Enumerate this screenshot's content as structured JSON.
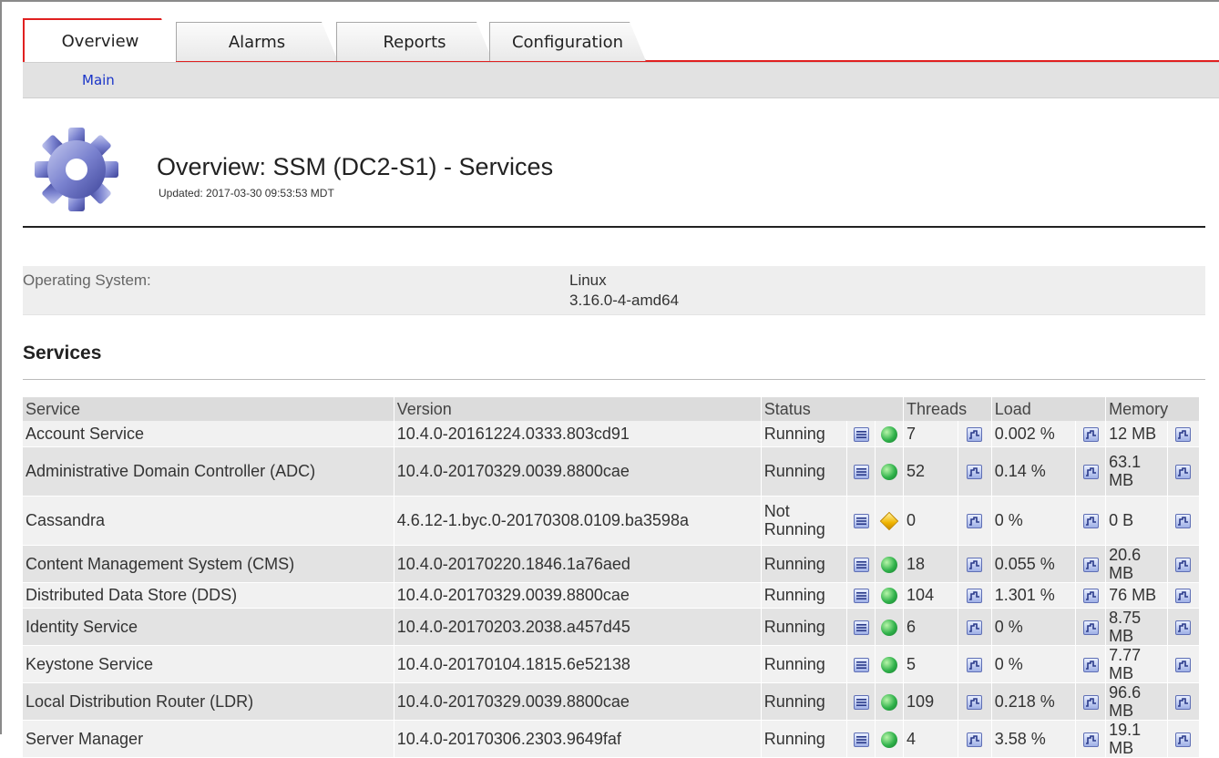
{
  "tabs": [
    {
      "label": "Overview",
      "active": true
    },
    {
      "label": "Alarms",
      "active": false
    },
    {
      "label": "Reports",
      "active": false
    },
    {
      "label": "Configuration",
      "active": false
    }
  ],
  "subnav": {
    "main": "Main"
  },
  "header": {
    "title": "Overview: SSM (DC2-S1) - Services",
    "updated": "Updated: 2017-03-30 09:53:53 MDT",
    "icon": "gear-icon"
  },
  "os": {
    "label": "Operating System:",
    "value_line1": "Linux",
    "value_line2": "3.16.0-4-amd64"
  },
  "services_heading": "Services",
  "table": {
    "headers": {
      "service": "Service",
      "version": "Version",
      "status": "Status",
      "threads": "Threads",
      "load": "Load",
      "memory": "Memory"
    },
    "rows": [
      {
        "service": "Account Service",
        "version": "10.4.0-20161224.0333.803cd91",
        "status": "Running",
        "state": "ok",
        "threads": "7",
        "load": "0.002 %",
        "memory": "12 MB"
      },
      {
        "service": "Administrative Domain Controller (ADC)",
        "version": "10.4.0-20170329.0039.8800cae",
        "status": "Running",
        "state": "ok",
        "threads": "52",
        "load": "0.14 %",
        "memory": "63.1 MB"
      },
      {
        "service": "Cassandra",
        "version": "4.6.12-1.byc.0-20170308.0109.ba3598a",
        "status": "Not Running",
        "state": "warn",
        "threads": "0",
        "load": "0 %",
        "memory": "0 B"
      },
      {
        "service": "Content Management System (CMS)",
        "version": "10.4.0-20170220.1846.1a76aed",
        "status": "Running",
        "state": "ok",
        "threads": "18",
        "load": "0.055 %",
        "memory": "20.6 MB"
      },
      {
        "service": "Distributed Data Store (DDS)",
        "version": "10.4.0-20170329.0039.8800cae",
        "status": "Running",
        "state": "ok",
        "threads": "104",
        "load": "1.301 %",
        "memory": "76 MB"
      },
      {
        "service": "Identity Service",
        "version": "10.4.0-20170203.2038.a457d45",
        "status": "Running",
        "state": "ok",
        "threads": "6",
        "load": "0 %",
        "memory": "8.75 MB"
      },
      {
        "service": "Keystone Service",
        "version": "10.4.0-20170104.1815.6e52138",
        "status": "Running",
        "state": "ok",
        "threads": "5",
        "load": "0 %",
        "memory": "7.77 MB"
      },
      {
        "service": "Local Distribution Router (LDR)",
        "version": "10.4.0-20170329.0039.8800cae",
        "status": "Running",
        "state": "ok",
        "threads": "109",
        "load": "0.218 %",
        "memory": "96.6 MB"
      },
      {
        "service": "Server Manager",
        "version": "10.4.0-20170306.2303.9649faf",
        "status": "Running",
        "state": "ok",
        "threads": "4",
        "load": "3.58 %",
        "memory": "19.1 MB"
      }
    ]
  }
}
